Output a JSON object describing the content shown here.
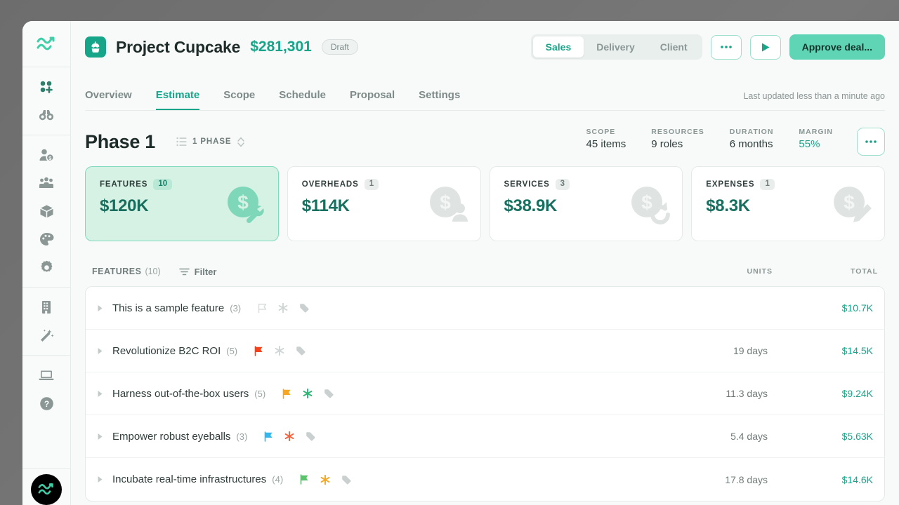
{
  "sidebar": {
    "logo_icon": "wave-logo-icon",
    "groups": [
      {
        "items": [
          {
            "name": "dashboard-grid-add-icon",
            "label": "Dashboard"
          },
          {
            "name": "binoculars-icon",
            "label": "Explore"
          }
        ]
      },
      {
        "items": [
          {
            "name": "person-dollar-icon",
            "label": "Deals"
          },
          {
            "name": "people-group-icon",
            "label": "People"
          },
          {
            "name": "box-cube-icon",
            "label": "Products"
          },
          {
            "name": "palette-icon",
            "label": "Brand"
          },
          {
            "name": "gear-icon",
            "label": "Settings"
          }
        ]
      },
      {
        "items": [
          {
            "name": "building-icon",
            "label": "Company"
          },
          {
            "name": "magic-wand-icon",
            "label": "Automations"
          }
        ]
      },
      {
        "items": [
          {
            "name": "laptop-icon",
            "label": "Preview"
          },
          {
            "name": "help-circle-icon",
            "label": "Help"
          }
        ]
      }
    ],
    "avatar_icon": "user-avatar-wave"
  },
  "header": {
    "project_icon": "cupcake-icon",
    "project_name": "Project Cupcake",
    "project_amount": "$281,301",
    "status_badge": "Draft",
    "segmented": {
      "options": [
        "Sales",
        "Delivery",
        "Client"
      ],
      "selected": "Sales"
    },
    "more_button_icon": "ellipsis-icon",
    "play_button_icon": "play-icon",
    "approve_button": "Approve deal...",
    "tabs": [
      {
        "label": "Overview",
        "active": false
      },
      {
        "label": "Estimate",
        "active": true
      },
      {
        "label": "Scope",
        "active": false
      },
      {
        "label": "Schedule",
        "active": false
      },
      {
        "label": "Proposal",
        "active": false
      },
      {
        "label": "Settings",
        "active": false
      }
    ],
    "last_updated": "Last updated less than a minute ago"
  },
  "phase": {
    "title": "Phase 1",
    "selector_icon": "list-ordered-icon",
    "selector_label": "1 PHASE",
    "selector_chevron": "chevron-updown-icon",
    "metrics": [
      {
        "label": "SCOPE",
        "value": "45 items",
        "accent": false
      },
      {
        "label": "RESOURCES",
        "value": "9 roles",
        "accent": false
      },
      {
        "label": "DURATION",
        "value": "6 months",
        "accent": false
      },
      {
        "label": "MARGIN",
        "value": "55%",
        "accent": true
      }
    ],
    "more_icon": "ellipsis-icon"
  },
  "cards": [
    {
      "label": "FEATURES",
      "count": "10",
      "value": "$120K",
      "active": true,
      "art": "dollar-wrench-icon"
    },
    {
      "label": "OVERHEADS",
      "count": "1",
      "value": "$114K",
      "active": false,
      "art": "dollar-person-icon"
    },
    {
      "label": "SERVICES",
      "count": "3",
      "value": "$38.9K",
      "active": false,
      "art": "dollar-refresh-icon"
    },
    {
      "label": "EXPENSES",
      "count": "1",
      "value": "$8.3K",
      "active": false,
      "art": "dollar-pencil-icon"
    }
  ],
  "table": {
    "section_label": "FEATURES",
    "section_count": "(10)",
    "filter_icon": "filter-icon",
    "filter_label": "Filter",
    "columns": {
      "units": "UNITS",
      "total": "TOTAL"
    },
    "rows": [
      {
        "name": "This is a sample feature",
        "count": "(3)",
        "flag_color": "#d9dedd",
        "star_color": "#d0d6d5",
        "tag_color": "#c9d0cf",
        "units": "",
        "total": "$10.7K"
      },
      {
        "name": "Revolutionize B2C ROI",
        "count": "(5)",
        "flag_color": "#f4431c",
        "star_color": "#d0d6d5",
        "tag_color": "#c9d0cf",
        "units": "19 days",
        "total": "$14.5K"
      },
      {
        "name": "Harness out-of-the-box users",
        "count": "(5)",
        "flag_color": "#f5a623",
        "star_color": "#2bb673",
        "tag_color": "#c9d0cf",
        "units": "11.3 days",
        "total": "$9.24K"
      },
      {
        "name": "Empower robust eyeballs",
        "count": "(3)",
        "flag_color": "#37b6e9",
        "star_color": "#f4603c",
        "tag_color": "#c9d0cf",
        "units": "5.4 days",
        "total": "$5.63K"
      },
      {
        "name": "Incubate real-time infrastructures",
        "count": "(4)",
        "flag_color": "#5ac26b",
        "star_color": "#f5a623",
        "tag_color": "#c9d0cf",
        "units": "17.8 days",
        "total": "$14.6K"
      }
    ]
  },
  "colors": {
    "accent": "#17a589",
    "accent_light": "#5fd5b5",
    "card_active_bg": "#d5f2e5",
    "text_dark": "#1d2b29",
    "text_muted": "#8b9795"
  }
}
